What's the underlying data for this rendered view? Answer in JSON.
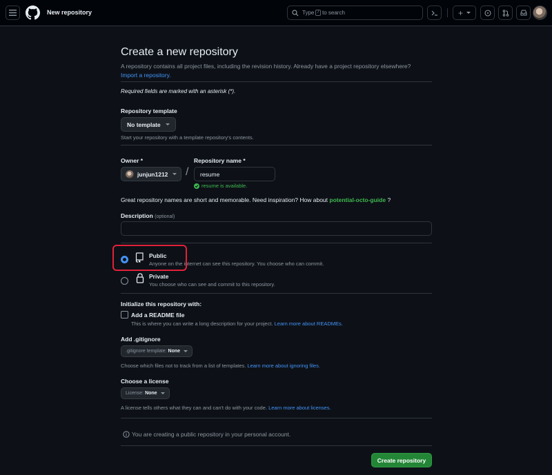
{
  "header": {
    "page_title": "New repository",
    "search_prefix": "Type",
    "search_key": "/",
    "search_suffix": "to search",
    "plus_label": "+"
  },
  "main": {
    "title": "Create a new repository",
    "subtitle": "A repository contains all project files, including the revision history. Already have a project repository elsewhere?",
    "import_link": "Import a repository.",
    "required_note": "Required fields are marked with an asterisk (*).",
    "template": {
      "label": "Repository template",
      "value": "No template",
      "note": "Start your repository with a template repository's contents."
    },
    "owner": {
      "label": "Owner *",
      "value": "junjun1212"
    },
    "separator": "/",
    "repo_name": {
      "label": "Repository name *",
      "value": "resume",
      "status": "resume is available."
    },
    "inspiration": {
      "text": "Great repository names are short and memorable. Need inspiration? How about",
      "suggestion": "potential-octo-guide",
      "end": "?"
    },
    "description": {
      "label": "Description",
      "optional": "(optional)",
      "value": ""
    },
    "visibility": {
      "public_title": "Public",
      "public_desc": "Anyone on the internet can see this repository. You choose who can commit.",
      "private_title": "Private",
      "private_desc": "You choose who can see and commit to this repository.",
      "selected": "public"
    },
    "initialize": {
      "label": "Initialize this repository with:",
      "readme_label": "Add a README file",
      "readme_desc": "This is where you can write a long description for your project.",
      "readme_link": "Learn more about READMEs."
    },
    "gitignore": {
      "label": "Add .gitignore",
      "btn_prefix": ".gitignore template:",
      "btn_value": "None",
      "note": "Choose which files not to track from a list of templates.",
      "link": "Learn more about ignoring files."
    },
    "license": {
      "label": "Choose a license",
      "btn_prefix": "License:",
      "btn_value": "None",
      "note": "A license tells others what they can and can't do with your code.",
      "link": "Learn more about licenses."
    },
    "info_text": "You are creating a public repository in your personal account.",
    "create_button": "Create repository"
  },
  "colors": {
    "background": "#0d1117",
    "accent_blue": "#4493f8",
    "success_green": "#238636",
    "highlight_red": "#e3213a"
  }
}
